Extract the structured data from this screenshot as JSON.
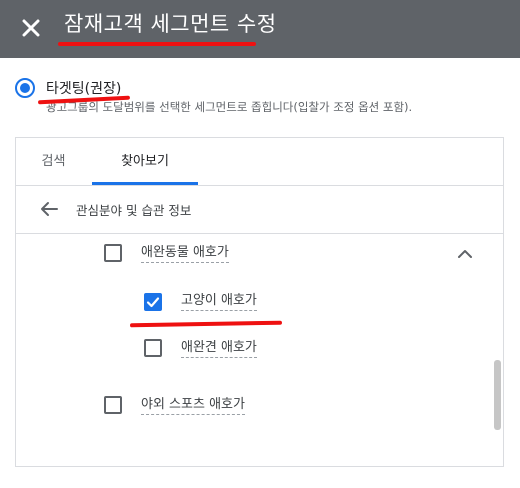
{
  "header": {
    "title": "잠재고객 세그먼트 수정",
    "close_icon": "close-icon"
  },
  "targeting": {
    "label": "타겟팅(권장)",
    "description": "광고그룹의 도달범위를 선택한 세그먼트로 좁힙니다(입찰가 조정 옵션 포함).",
    "selected": true
  },
  "tabs": [
    {
      "label": "검색",
      "active": false
    },
    {
      "label": "찾아보기",
      "active": true
    }
  ],
  "breadcrumb": {
    "back_icon": "arrow-back-icon",
    "label": "관심분야 및 습관 정보"
  },
  "items": [
    {
      "label": "애완동물 애호가",
      "checked": false,
      "expanded": true
    },
    {
      "label": "고양이 애호가",
      "checked": true
    },
    {
      "label": "애완견 애호가",
      "checked": false
    },
    {
      "label": "야외 스포츠 애호가",
      "checked": false
    }
  ],
  "colors": {
    "header_bg": "#5f6368",
    "accent": "#1a73e8",
    "annotation": "#ee1111"
  }
}
